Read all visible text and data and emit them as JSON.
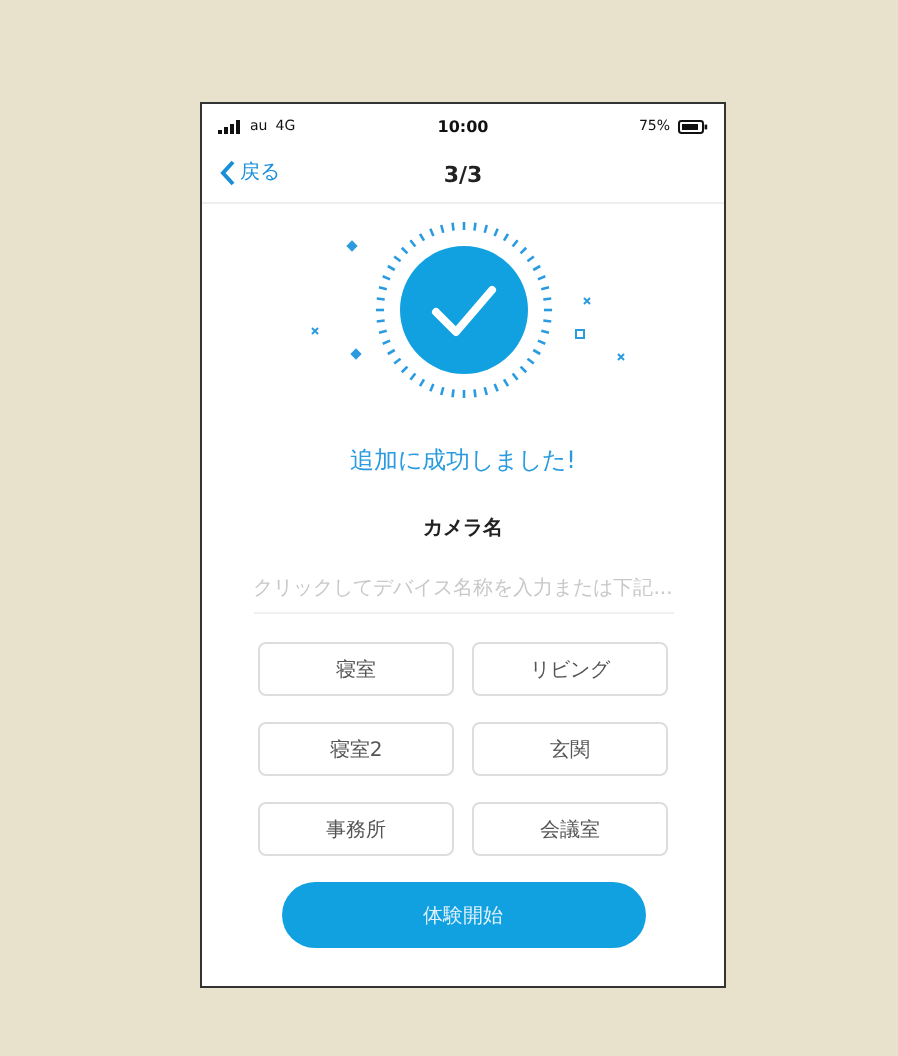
{
  "status_bar": {
    "carrier": "au",
    "network": "4G",
    "time": "10:00",
    "battery": "75%"
  },
  "nav": {
    "back": "戻る",
    "title": "3/3"
  },
  "message": "追加に成功しました!",
  "camera_name": {
    "label": "カメラ名",
    "placeholder": "クリックしてデバイス名称を入力または下記..."
  },
  "presets": [
    "寝室",
    "リビング",
    "寝室2",
    "玄関",
    "事務所",
    "会議室"
  ],
  "start_button": "体験開始"
}
